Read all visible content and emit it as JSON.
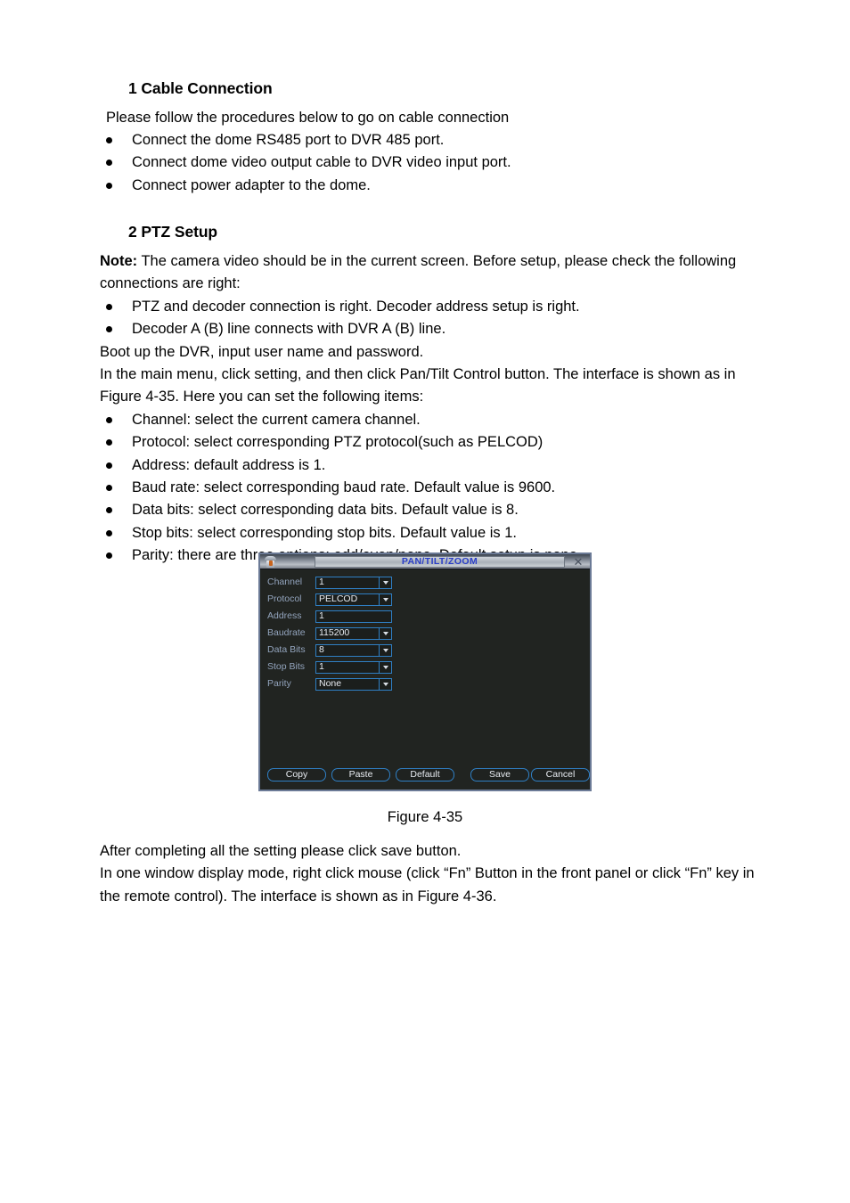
{
  "document": {
    "section1": {
      "heading": "1 Cable Connection",
      "lead": "Please follow the procedures below to go on cable connection",
      "bullets": [
        "Connect the dome RS485 port to DVR 485 port.",
        "Connect dome video output cable to DVR video input port.",
        "Connect power adapter to the dome."
      ]
    },
    "section2": {
      "heading": "2 PTZ Setup",
      "note_label": "Note:",
      "note_text": " The camera video should be in the current screen. Before setup, please check the following connections are right:",
      "check_bullets": [
        "PTZ and decoder connection is right. Decoder address setup is right.",
        "Decoder A (B) line connects with DVR A (B) line."
      ],
      "boot_line": "Boot up the DVR, input user name and password.",
      "menu_line": "In the main menu, click setting, and then click Pan/Tilt Control button. The interface is shown as in Figure 4-35. Here you can set the following items:",
      "item_bullets": [
        "Channel: select the current camera channel.",
        "Protocol: select corresponding PTZ protocol(such as PELCOD)",
        "Address: default address is 1.",
        "Baud rate: select corresponding baud rate. Default value is 9600.",
        "Data bits: select corresponding data bits. Default value is 8.",
        "Stop bits: select corresponding stop bits. Default value is 1.",
        "Parity: there are three options: odd/even/none. Default setup is none."
      ]
    },
    "figure_caption": "Figure 4-35",
    "tail_lines": [
      "After completing all the setting please click save button.",
      "In one window display mode, right click mouse (click “Fn” Button in the front panel or click “Fn” key in the remote control). The interface is shown as in Figure 4-36."
    ]
  },
  "ptz_dialog": {
    "title": "PAN/TILT/ZOOM",
    "close_glyph": "✕",
    "icon_name": "dome-camera-icon",
    "fields": [
      {
        "label": "Channel",
        "value": "1",
        "type": "select"
      },
      {
        "label": "Protocol",
        "value": "PELCOD",
        "type": "select"
      },
      {
        "label": "Address",
        "value": "1",
        "type": "text"
      },
      {
        "label": "Baudrate",
        "value": "115200",
        "type": "select"
      },
      {
        "label": "Data Bits",
        "value": "8",
        "type": "select"
      },
      {
        "label": "Stop Bits",
        "value": "1",
        "type": "select"
      },
      {
        "label": "Parity",
        "value": "None",
        "type": "select"
      }
    ],
    "buttons": {
      "copy": "Copy",
      "paste": "Paste",
      "default": "Default",
      "save": "Save",
      "cancel": "Cancel"
    },
    "colors": {
      "dialog_background": "#212421",
      "field_border": "#2f7fc4",
      "label_text": "#93a4bd",
      "title_text": "#2a3ec8",
      "outer_border": "#6b7a96"
    }
  }
}
